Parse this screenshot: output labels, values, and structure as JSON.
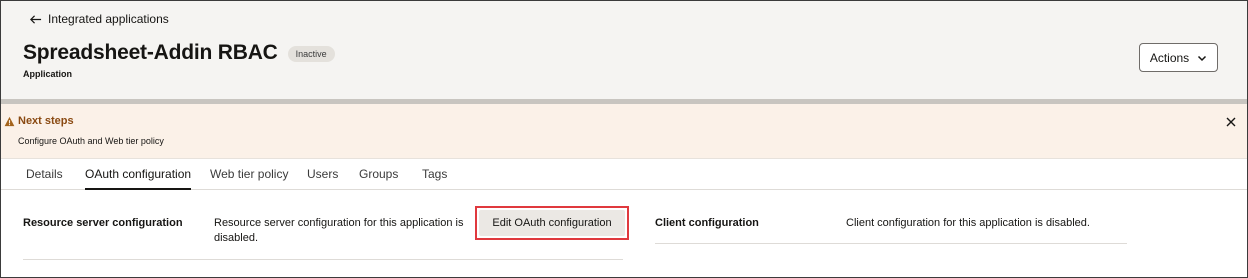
{
  "header": {
    "back_link": "Integrated applications",
    "title": "Spreadsheet-Addin RBAC",
    "status_badge": "Inactive",
    "subtitle": "Application",
    "actions_label": "Actions"
  },
  "banner": {
    "title": "Next steps",
    "text": "Configure OAuth and Web tier policy",
    "icon": "warning-icon",
    "close_icon": "close-icon"
  },
  "tabs": [
    {
      "label": "Details",
      "active": false
    },
    {
      "label": "OAuth configuration",
      "active": true
    },
    {
      "label": "Web tier policy",
      "active": false
    },
    {
      "label": "Users",
      "active": false
    },
    {
      "label": "Groups",
      "active": false
    },
    {
      "label": "Tags",
      "active": false
    }
  ],
  "resource_server": {
    "label": "Resource server configuration",
    "description": "Resource server configuration for this application is disabled.",
    "edit_button": "Edit OAuth configuration"
  },
  "client": {
    "label": "Client configuration",
    "description": "Client configuration for this application is disabled."
  },
  "colors": {
    "header_bg": "#f5f4f2",
    "banner_bg": "#fbf1e8",
    "warning": "#a3631b",
    "highlight": "#e0393e"
  }
}
